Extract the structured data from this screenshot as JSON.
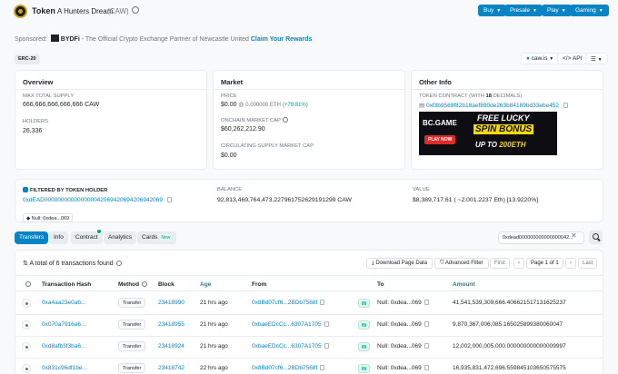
{
  "header": {
    "token_label": "Token",
    "token_name": "A Hunters Dream",
    "token_symbol": "(CAW)",
    "buttons": [
      "Buy",
      "Presale",
      "Play",
      "Gaming"
    ]
  },
  "sponsor": {
    "prefix": "Sponsored:",
    "brand": "BYDFi",
    "text": " - The Official Crypto Exchange Partner of Newcastle United ",
    "link": "Claim Your Rewards"
  },
  "subheader": {
    "standard": "ERC-20",
    "site_pill": "caw.is",
    "api_pill": "API"
  },
  "overview": {
    "title": "Overview",
    "max_supply_label": "MAX TOTAL SUPPLY",
    "max_supply_value": "666,666,666,666,666 CAW",
    "holders_label": "HOLDERS",
    "holders_value": "26,336"
  },
  "market": {
    "title": "Market",
    "price_label": "PRICE",
    "price_value": "$0.00",
    "price_eth": "@ 0.000000 ETH",
    "price_change": "(+79.81%)",
    "mcap_label": "ONCHAIN MARKET CAP",
    "mcap_value": "$60,262,212.90",
    "circ_label": "CIRCULATING SUPPLY MARKET CAP",
    "circ_value": "$0.00"
  },
  "other_info": {
    "title": "Other Info",
    "contract_label_prefix": "TOKEN CONTRACT (WITH ",
    "contract_decimals": "18",
    "contract_label_suffix": " DECIMALS)",
    "contract_address": "0xf3b9569f82b18aef890de263b84189bd33ebe452",
    "ad": {
      "brand": "BC.GAME",
      "line1": "FREE LUCKY",
      "line2": "SPIN BONUS",
      "line3_prefix": "UP TO ",
      "line3_amount": "200ETH",
      "cta": "PLAY NOW"
    }
  },
  "filter_card": {
    "title": "FILTERED BY TOKEN HOLDER",
    "address": "0xdEAD000000000000000042069420694206942069",
    "null_pill": "Null: 0xdea...069",
    "balance_label": "BALANCE",
    "balance_value": "92,813,469,764,473.227961752629191299 CAW",
    "value_label": "VALUE",
    "value_value": "$8,389,717.61 ( ~2,001.2237 Eth) [13.9220%]"
  },
  "tabs": {
    "transfers": "Transfers",
    "info": "Info",
    "contract": "Contract",
    "analytics": "Analytics",
    "cards": "Cards",
    "cards_badge": "New",
    "address_filter": "0xdead000000000000000042..."
  },
  "table": {
    "total_text": "A total of 6 transactions found",
    "download": "Download Page Data",
    "advanced_filter": "Advanced Filter",
    "first": "First",
    "page_info": "Page 1 of 1",
    "last": "Last",
    "headers": {
      "hash": "Transaction Hash",
      "method": "Method",
      "block": "Block",
      "age": "Age",
      "from": "From",
      "to": "To",
      "amount": "Amount"
    },
    "rows": [
      {
        "hash": "0xa4aa23e0ab...",
        "method": "Transfer",
        "block": "23418990",
        "age": "21 hrs ago",
        "from": "0x8Bd07cf6...2BDb7568f",
        "dir": "IN",
        "to": "Null: 0xdea...069",
        "amount": "41,541,539,309,666.406621517131625237"
      },
      {
        "hash": "0x070a7916a6...",
        "method": "Transfer",
        "block": "23418955",
        "age": "21 hrs ago",
        "from": "0xbaeEDcCc...6307A1705",
        "dir": "IN",
        "to": "Null: 0xdea...069",
        "amount": "9,870,367,006,085.165025899380060047"
      },
      {
        "hash": "0xd8afb3f3ba6...",
        "method": "Transfer",
        "block": "23418924",
        "age": "21 hrs ago",
        "from": "0xbaeEDcCc...6307A1705",
        "dir": "IN",
        "to": "Null: 0xdea...069",
        "amount": "12,002,000,005,000.000000000000009997"
      },
      {
        "hash": "0x831c96df1be...",
        "method": "Transfer",
        "block": "23418742",
        "age": "22 hrs ago",
        "from": "0x8Bd07cf6...2BDb7568f",
        "dir": "IN",
        "to": "Null: 0xdea...069",
        "amount": "16,935,831,472,696.559845103650575575"
      }
    ]
  },
  "colors": {
    "accent": "#0784c3",
    "success": "#00a186",
    "background": "#f8f9fa"
  }
}
